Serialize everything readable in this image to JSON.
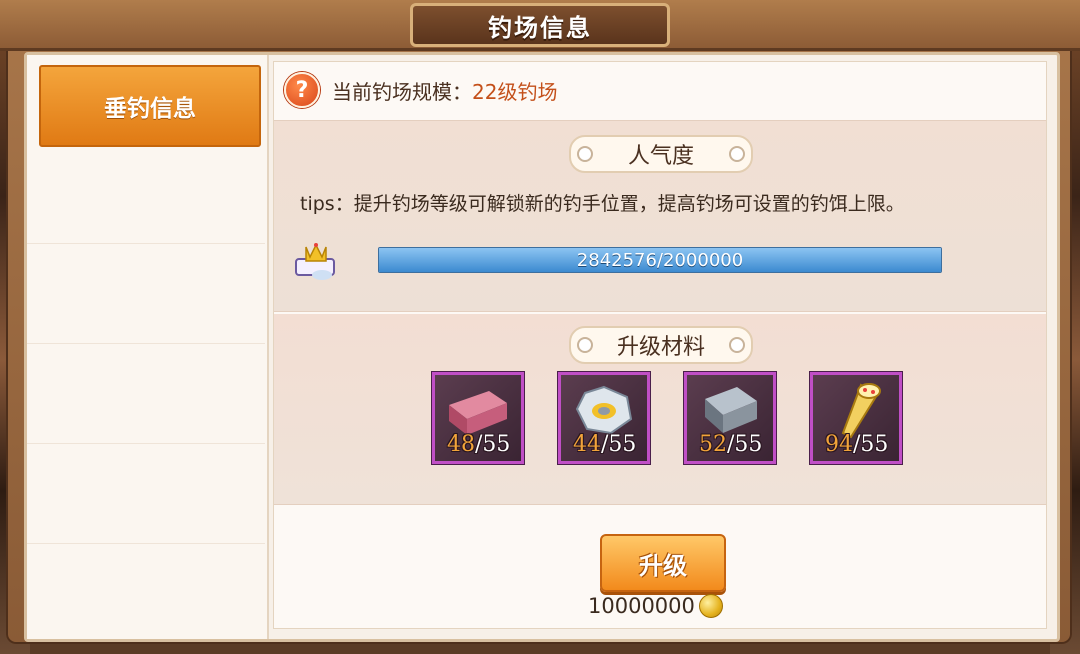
{
  "window": {
    "title": "钓场信息"
  },
  "sidebar": {
    "items": [
      {
        "label": "垂钓信息",
        "active": true
      }
    ]
  },
  "scale": {
    "label": "当前钓场规模：",
    "value": "22级钓场",
    "help_icon": "question-icon"
  },
  "popularity": {
    "heading": "人气度",
    "tips": "tips：提升钓场等级可解锁新的钓手位置，提高钓场可设置的钓饵上限。",
    "progress_text": "2842576/2000000",
    "progress_fraction": 1.0,
    "icon": "crown-ticket-icon"
  },
  "materials": {
    "heading": "升级材料",
    "items": [
      {
        "icon": "wood-plank-icon",
        "have": "48",
        "need": "/55"
      },
      {
        "icon": "stone-ring-icon",
        "have": "44",
        "need": "/55"
      },
      {
        "icon": "iron-ingot-icon",
        "have": "52",
        "need": "/55"
      },
      {
        "icon": "golden-screw-icon",
        "have": "94",
        "need": "/55"
      }
    ]
  },
  "upgrade": {
    "label": "升级",
    "cost": "10000000",
    "currency_icon": "coin-icon"
  },
  "colors": {
    "accent": "#f28a1c",
    "frame": "#8a5b36",
    "progress": "#3c8ad0",
    "item_border": "#c04fc6"
  }
}
